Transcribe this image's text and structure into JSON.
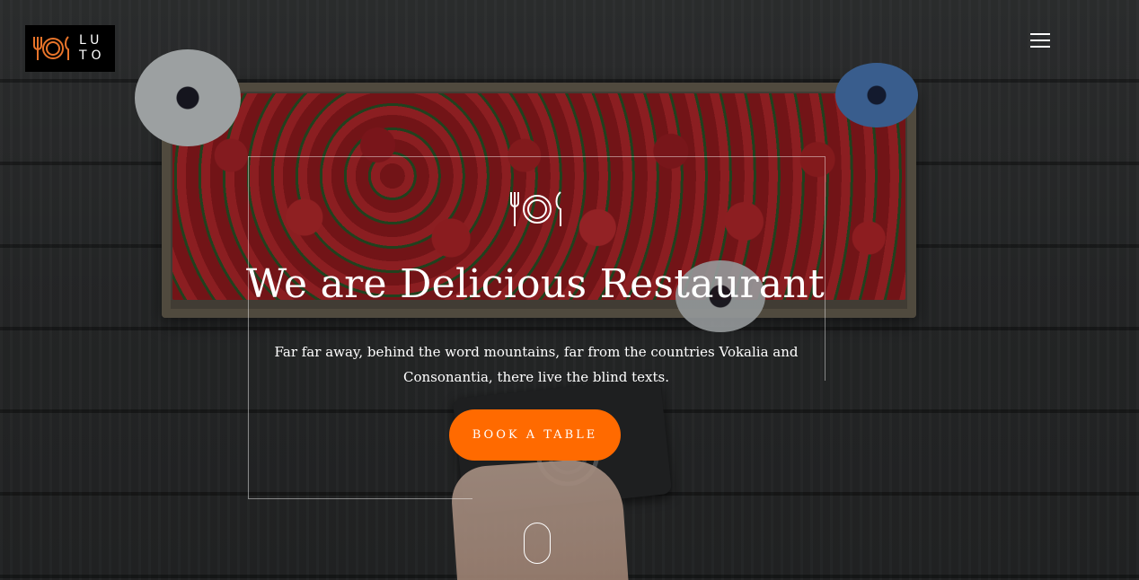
{
  "header": {
    "logo_line1": "LU",
    "logo_line2": "TO",
    "menu_icon": "hamburger-menu-icon",
    "logo_accent": "#e8742a"
  },
  "hero": {
    "icon": "fork-plate-knife-icon",
    "title": "We are Delicious Restaurant",
    "subtitle": "Far far away, behind the word mountains, far from the countries Vokalia and Consonantia, there live the blind texts.",
    "cta_label": "BOOK A TABLE",
    "cta_color": "#ff6a00",
    "scroll_icon": "mouse-scroll-icon"
  }
}
